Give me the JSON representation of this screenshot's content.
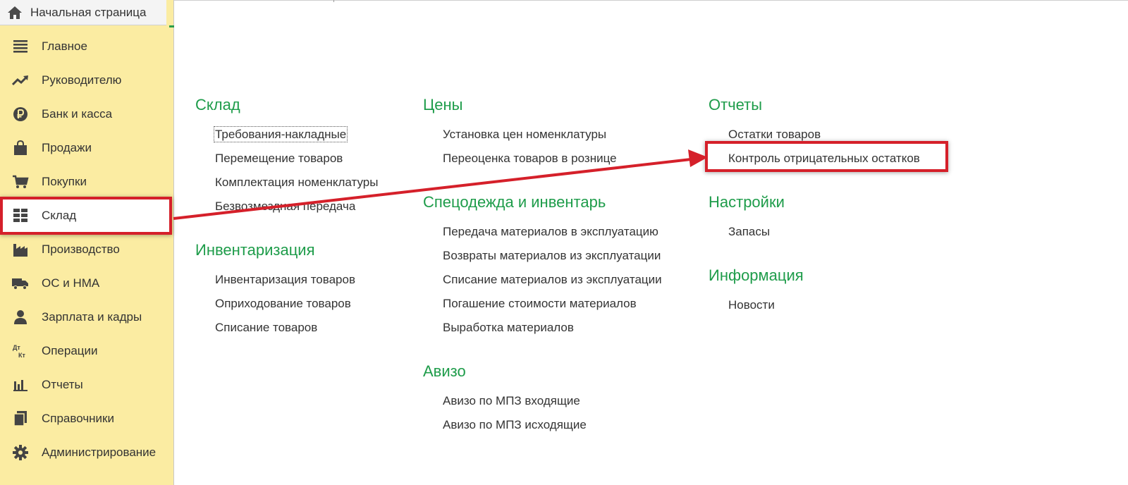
{
  "home_tab": {
    "label": "Начальная страница",
    "icon": "home-icon"
  },
  "sidebar": {
    "items": [
      {
        "label": "Главное",
        "icon": "menu-lines-icon"
      },
      {
        "label": "Руководителю",
        "icon": "trend-up-icon"
      },
      {
        "label": "Банк и касса",
        "icon": "ruble-icon"
      },
      {
        "label": "Продажи",
        "icon": "shopping-bag-icon"
      },
      {
        "label": "Покупки",
        "icon": "cart-icon"
      },
      {
        "label": "Склад",
        "icon": "warehouse-grid-icon",
        "highlighted": true
      },
      {
        "label": "Производство",
        "icon": "factory-icon"
      },
      {
        "label": "ОС и НМА",
        "icon": "truck-icon"
      },
      {
        "label": "Зарплата и кадры",
        "icon": "person-icon"
      },
      {
        "label": "Операции",
        "icon": "dt-kt-icon"
      },
      {
        "label": "Отчеты",
        "icon": "bar-chart-icon"
      },
      {
        "label": "Справочники",
        "icon": "books-icon"
      },
      {
        "label": "Администрирование",
        "icon": "gear-icon"
      }
    ],
    "dt_kt": {
      "dt": "Дт",
      "kt": "Кт"
    }
  },
  "columns": [
    {
      "sections": [
        {
          "title": "Склад",
          "links": [
            "Требования-накладные",
            "Перемещение товаров",
            "Комплектация номенклатуры",
            "Безвозмездная передача"
          ]
        },
        {
          "title": "Инвентаризация",
          "links": [
            "Инвентаризация товаров",
            "Оприходование товаров",
            "Списание товаров"
          ]
        }
      ]
    },
    {
      "sections": [
        {
          "title": "Цены",
          "links": [
            "Установка цен номенклатуры",
            "Переоценка товаров в рознице"
          ]
        },
        {
          "title": "Спецодежда и инвентарь",
          "links": [
            "Передача материалов в эксплуатацию",
            "Возвраты материалов из эксплуатации",
            "Списание материалов из эксплуатации",
            "Погашение стоимости материалов",
            "Выработка материалов"
          ]
        },
        {
          "title": "Авизо",
          "links": [
            "Авизо по МПЗ входящие",
            "Авизо по МПЗ исходящие"
          ]
        }
      ]
    },
    {
      "sections": [
        {
          "title": "Отчеты",
          "links": [
            "Остатки товаров",
            "Контроль отрицательных остатков"
          ]
        },
        {
          "title": "Настройки",
          "links": [
            "Запасы"
          ]
        },
        {
          "title": "Информация",
          "links": [
            "Новости"
          ]
        }
      ]
    }
  ],
  "colors": {
    "sidebar_bg": "#fbeca2",
    "section_title": "#1e9c4a",
    "annotation_red": "#d5202a"
  }
}
